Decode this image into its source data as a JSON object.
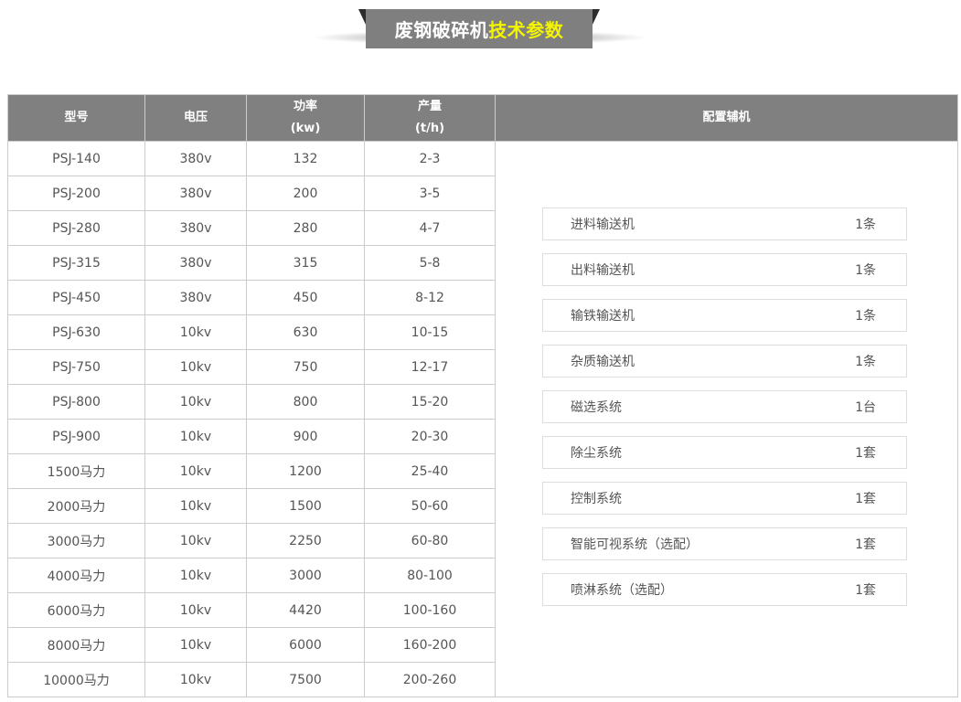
{
  "banner": {
    "title_plain": "废钢破碎机",
    "title_highlight": "技术参数"
  },
  "table": {
    "headers": {
      "model": "型号",
      "voltage": "电压",
      "power_label": "功率",
      "power_unit": "(kw)",
      "output_label": "产量",
      "output_unit": "(t/h)",
      "auxiliary": "配置辅机"
    },
    "rows": [
      [
        "PSJ-140",
        "380v",
        "132",
        "2-3"
      ],
      [
        "PSJ-200",
        "380v",
        "200",
        "3-5"
      ],
      [
        "PSJ-280",
        "380v",
        "280",
        "4-7"
      ],
      [
        "PSJ-315",
        "380v",
        "315",
        "5-8"
      ],
      [
        "PSJ-450",
        "380v",
        "450",
        "8-12"
      ],
      [
        "PSJ-630",
        "10kv",
        "630",
        "10-15"
      ],
      [
        "PSJ-750",
        "10kv",
        "750",
        "12-17"
      ],
      [
        "PSJ-800",
        "10kv",
        "800",
        "15-20"
      ],
      [
        "PSJ-900",
        "10kv",
        "900",
        "20-30"
      ],
      [
        "1500马力",
        "10kv",
        "1200",
        "25-40"
      ],
      [
        "2000马力",
        "10kv",
        "1500",
        "50-60"
      ],
      [
        "3000马力",
        "10kv",
        "2250",
        "60-80"
      ],
      [
        "4000马力",
        "10kv",
        "3000",
        "80-100"
      ],
      [
        "6000马力",
        "10kv",
        "4420",
        "100-160"
      ],
      [
        "8000马力",
        "10kv",
        "6000",
        "160-200"
      ],
      [
        "10000马力",
        "10kv",
        "7500",
        "200-260"
      ]
    ],
    "auxiliary": [
      {
        "name": "进料输送机",
        "qty": "1条"
      },
      {
        "name": "出料输送机",
        "qty": "1条"
      },
      {
        "name": "输铁输送机",
        "qty": "1条"
      },
      {
        "name": "杂质输送机",
        "qty": "1条"
      },
      {
        "name": "磁选系统",
        "qty": "1台"
      },
      {
        "name": "除尘系统",
        "qty": "1套"
      },
      {
        "name": "控制系统",
        "qty": "1套"
      },
      {
        "name": "智能可视系统（选配）",
        "qty": "1套"
      },
      {
        "name": "喷淋系统（选配）",
        "qty": "1套"
      }
    ]
  },
  "colors": {
    "header_bg": "#808080",
    "highlight": "#f5f500",
    "border": "#cccccc",
    "text": "#555555"
  }
}
